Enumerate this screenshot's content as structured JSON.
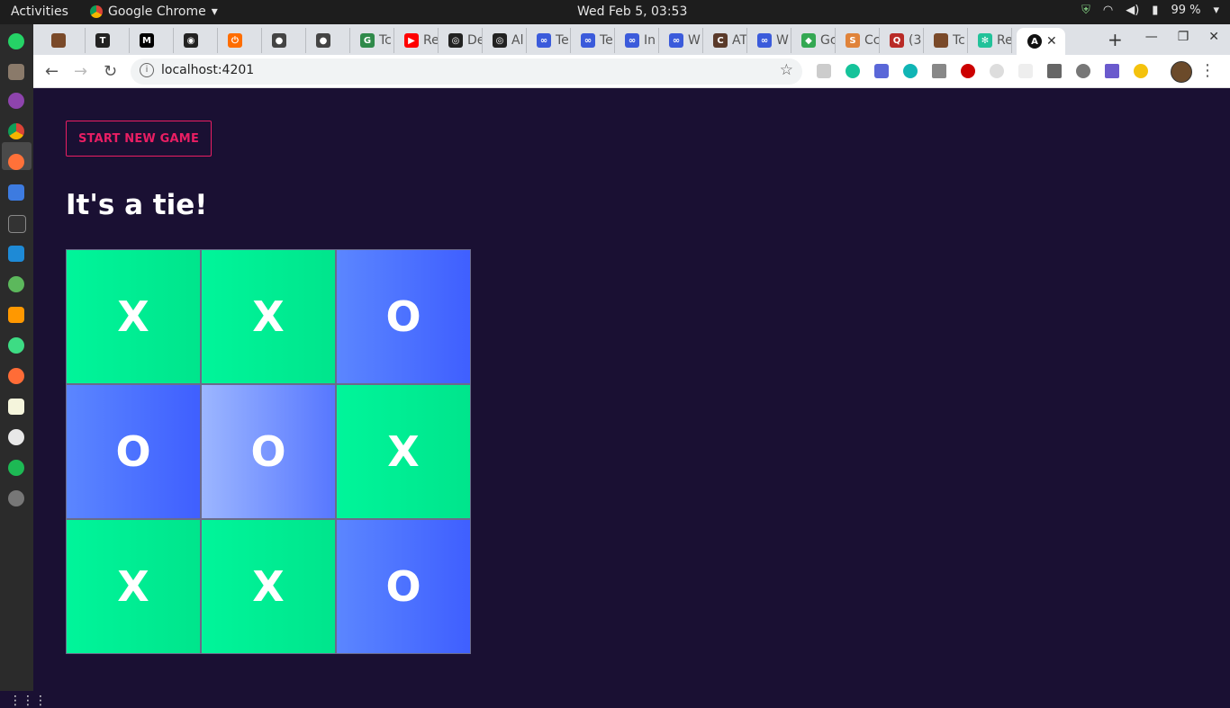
{
  "system": {
    "activities": "Activities",
    "app_name": "Google Chrome",
    "clock": "Wed Feb  5, 03:53",
    "battery": "99 %"
  },
  "browser": {
    "tabs": [
      {
        "label": "",
        "fav_color": "#7a4a2a"
      },
      {
        "label": "",
        "fav_color": "#222222",
        "glyph": "T"
      },
      {
        "label": "",
        "fav_color": "#000000",
        "glyph": "M"
      },
      {
        "label": "",
        "fav_color": "#222222",
        "glyph": "◉"
      },
      {
        "label": "",
        "fav_color": "#ff6d00",
        "glyph": "⏻"
      },
      {
        "label": "",
        "fav_color": "#444444",
        "glyph": "●"
      },
      {
        "label": "",
        "fav_color": "#444444",
        "glyph": "●"
      },
      {
        "label": "Tc",
        "fav_color": "#2f8a4a",
        "glyph": "G"
      },
      {
        "label": "Re",
        "fav_color": "#ff0000",
        "glyph": "▶"
      },
      {
        "label": "De",
        "fav_color": "#222222",
        "glyph": "◎"
      },
      {
        "label": "Al",
        "fav_color": "#222222",
        "glyph": "◎"
      },
      {
        "label": "Te",
        "fav_color": "#3b5bdb",
        "glyph": "∞"
      },
      {
        "label": "Te",
        "fav_color": "#3b5bdb",
        "glyph": "∞"
      },
      {
        "label": "In",
        "fav_color": "#3b5bdb",
        "glyph": "∞"
      },
      {
        "label": "W",
        "fav_color": "#3b5bdb",
        "glyph": "∞"
      },
      {
        "label": "AT",
        "fav_color": "#5a3a2a",
        "glyph": "C"
      },
      {
        "label": "W",
        "fav_color": "#3b5bdb",
        "glyph": "∞"
      },
      {
        "label": "Gc",
        "fav_color": "#34a853",
        "glyph": "◆"
      },
      {
        "label": "Cc",
        "fav_color": "#e0833a",
        "glyph": "S"
      },
      {
        "label": "(3",
        "fav_color": "#b92b27",
        "glyph": "Q"
      },
      {
        "label": "Tc",
        "fav_color": "#7a4a2a",
        "glyph": ""
      },
      {
        "label": "Re",
        "fav_color": "#22c29a",
        "glyph": "✻"
      }
    ],
    "active_tab_glyph": "A",
    "new_tab": "+",
    "url": "localhost:4201"
  },
  "app": {
    "start_button": "Start new game",
    "status": "It's a tie!",
    "board": [
      "X",
      "X",
      "O",
      "O",
      "O",
      "X",
      "X",
      "X",
      "O"
    ]
  },
  "colors": {
    "page_background": "#1a1033",
    "accent": "#e91e63",
    "x_tile": "#00f59a",
    "o_tile": "#4a6cff"
  }
}
